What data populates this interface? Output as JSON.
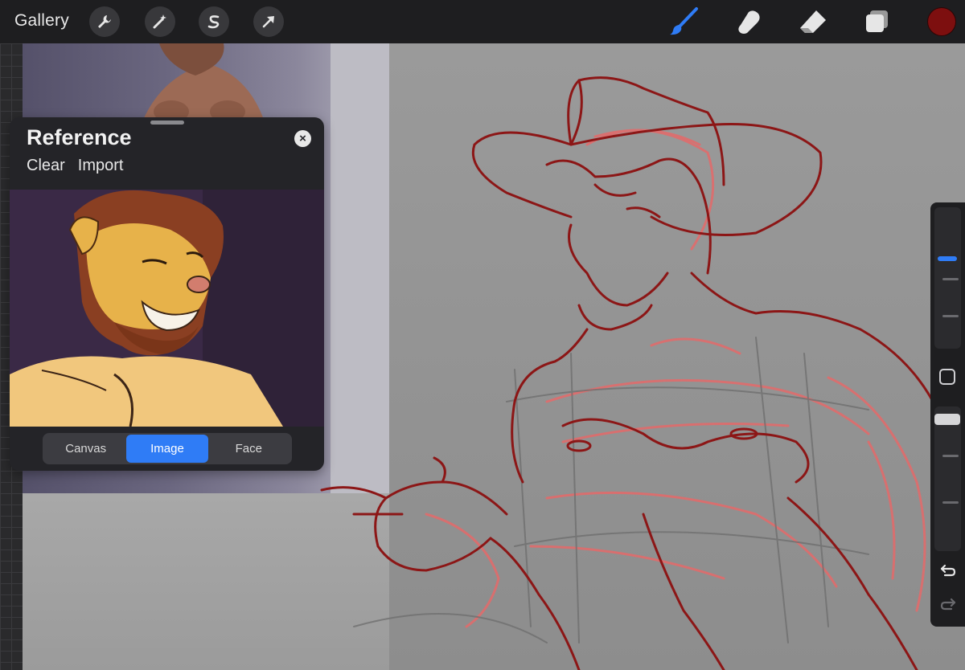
{
  "topbar": {
    "gallery_label": "Gallery",
    "left_tools": [
      "wrench-icon",
      "magic-wand-icon",
      "selection-s-icon",
      "transform-arrow-icon"
    ],
    "right_tools": [
      "brush-icon",
      "smudge-icon",
      "eraser-icon",
      "layers-icon"
    ],
    "active_tool": "brush-icon",
    "accent_color": "#2f7cf6",
    "current_color": "#7d0f0f"
  },
  "reference": {
    "title": "Reference",
    "clear_label": "Clear",
    "import_label": "Import",
    "modes": [
      "Canvas",
      "Image",
      "Face"
    ],
    "active_mode": "Image"
  },
  "sidebar": {
    "square_button": "modify-square-icon",
    "undo": "undo-icon",
    "redo": "redo-icon"
  }
}
